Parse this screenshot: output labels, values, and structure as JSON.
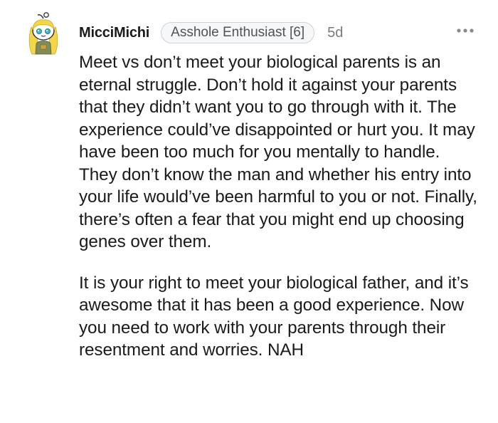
{
  "comment": {
    "author": "MicciMichi",
    "flair": "Asshole Enthusiast [6]",
    "time_ago": "5d",
    "menu_icon": "more-horizontal-icon",
    "avatar_icon": "snoo-avatar-icon",
    "paragraphs": [
      "Meet vs don’t meet your biological parents is an eternal struggle. Don’t hold it against your parents that they didn’t want you to go through with it. The experience could’ve disappointed or hurt you. It may have been too much for you mentally to handle. They don’t know the man and whether his entry into your life would’ve been harmful to you or not. Finally, there’s often a fear that you might end up choosing genes over them.",
      "It is your right to meet your biological father, and it’s awesome that it has been a good experience. Now you need to work with your parents through their resentment and worries. NAH"
    ]
  }
}
